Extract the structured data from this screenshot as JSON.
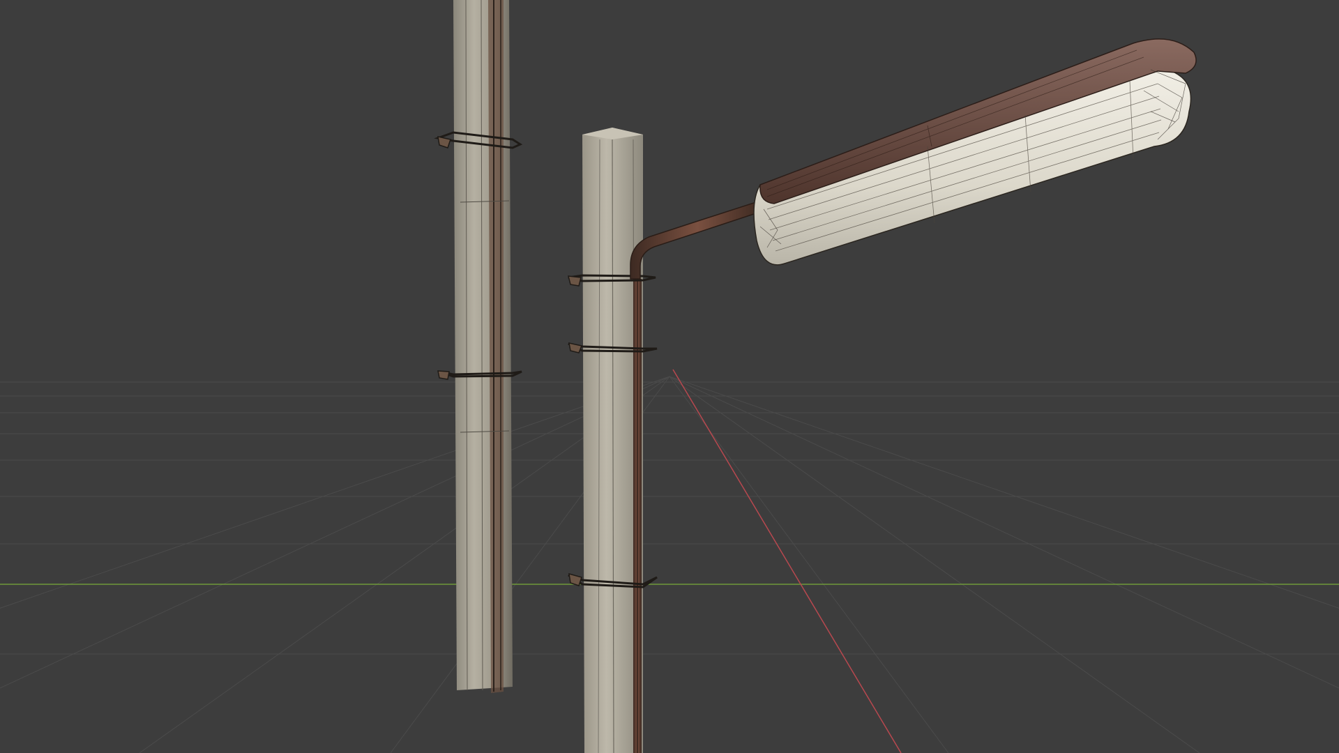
{
  "viewport": {
    "name": "3D Viewport",
    "shading": "wireframe-over-solid",
    "background": "#3d3d3d"
  },
  "colors": {
    "background": "#3d3d3d",
    "grid_line": "#4a4a4a",
    "x_axis": "#b8484f",
    "y_axis": "#6f9a3a",
    "concrete": "#a8a396",
    "concrete_shadow": "#7d796e",
    "wire": "#2a2620",
    "rust": "#6e4535",
    "lamp_glass": "#e6e2d6",
    "lamp_hood": "#6a4d44"
  },
  "objects": [
    {
      "name": "concrete-pole-left",
      "type": "mesh"
    },
    {
      "name": "concrete-pole-right",
      "type": "mesh"
    },
    {
      "name": "street-lamp-arm",
      "type": "mesh"
    },
    {
      "name": "street-lamp-head",
      "type": "mesh"
    }
  ]
}
